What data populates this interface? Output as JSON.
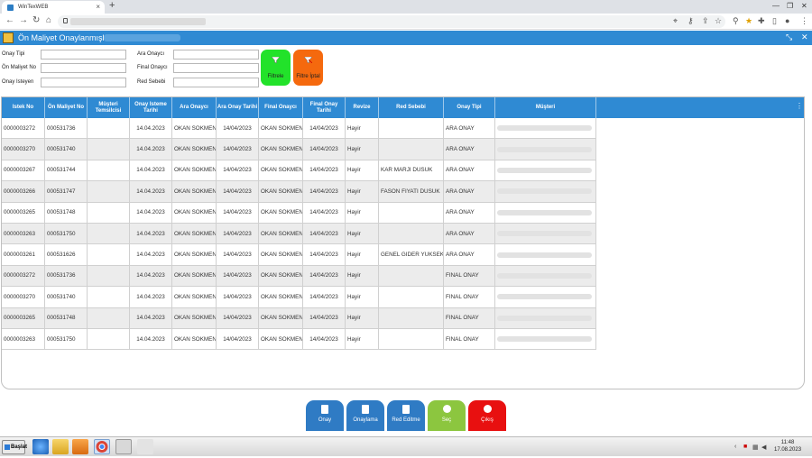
{
  "browser": {
    "tab_title": "WinTexWEB",
    "new_tab": "+",
    "tab_close": "×"
  },
  "app": {
    "title": "Ön Maliyet Onaylanmışlar /"
  },
  "filters": {
    "onay_tipi": "Onay Tipi",
    "on_maliyet_no": "Ön Maliyet No",
    "onay_isteyen": "Onay Isteyen",
    "ara_onayci": "Ara Onaycı",
    "final_onayci": "Final Onaycı",
    "red_sebebi": "Red Sebebi",
    "filter_button": "Filtrele",
    "filter_cancel_button": "Filtre İptal"
  },
  "table": {
    "columns": [
      "Istek No",
      "Ön Maliyet No",
      "Müşteri Temsilcisi",
      "Onay Isteme Tarihi",
      "Ara Onaycı",
      "Ara Onay Tarihi",
      "Final Onaycı",
      "Final Onay Tarihi",
      "Revize",
      "Red Sebebi",
      "Onay Tipi",
      "Müşteri"
    ],
    "rows": [
      {
        "istek_no": "0000003272",
        "on_maliyet_no": "000531736",
        "temsilci": "",
        "isteme_tarihi": "14.04.2023",
        "ara_onayci": "OKAN SOKMEN",
        "ara_onay_tarihi": "14/04/2023",
        "final_onayci": "OKAN SOKMEN",
        "final_onay_tarihi": "14/04/2023",
        "revize": "Hayir",
        "red_sebebi": "",
        "onay_tipi": "ARA ONAY"
      },
      {
        "istek_no": "0000003270",
        "on_maliyet_no": "000531740",
        "temsilci": "",
        "isteme_tarihi": "14.04.2023",
        "ara_onayci": "OKAN SOKMEN",
        "ara_onay_tarihi": "14/04/2023",
        "final_onayci": "OKAN SOKMEN",
        "final_onay_tarihi": "14/04/2023",
        "revize": "Hayir",
        "red_sebebi": "",
        "onay_tipi": "ARA ONAY"
      },
      {
        "istek_no": "0000003267",
        "on_maliyet_no": "000531744",
        "temsilci": "",
        "isteme_tarihi": "14.04.2023",
        "ara_onayci": "OKAN SOKMEN",
        "ara_onay_tarihi": "14/04/2023",
        "final_onayci": "OKAN SOKMEN",
        "final_onay_tarihi": "14/04/2023",
        "revize": "Hayir",
        "red_sebebi": "KAR MARJI DUSUK",
        "onay_tipi": "ARA ONAY"
      },
      {
        "istek_no": "0000003266",
        "on_maliyet_no": "000531747",
        "temsilci": "",
        "isteme_tarihi": "14.04.2023",
        "ara_onayci": "OKAN SOKMEN",
        "ara_onay_tarihi": "14/04/2023",
        "final_onayci": "OKAN SOKMEN",
        "final_onay_tarihi": "14/04/2023",
        "revize": "Hayir",
        "red_sebebi": "FASON FIYATI DUSUK",
        "onay_tipi": "ARA ONAY"
      },
      {
        "istek_no": "0000003265",
        "on_maliyet_no": "000531748",
        "temsilci": "",
        "isteme_tarihi": "14.04.2023",
        "ara_onayci": "OKAN SOKMEN",
        "ara_onay_tarihi": "14/04/2023",
        "final_onayci": "OKAN SOKMEN",
        "final_onay_tarihi": "14/04/2023",
        "revize": "Hayir",
        "red_sebebi": "",
        "onay_tipi": "ARA ONAY"
      },
      {
        "istek_no": "0000003263",
        "on_maliyet_no": "000531750",
        "temsilci": "",
        "isteme_tarihi": "14.04.2023",
        "ara_onayci": "OKAN SOKMEN",
        "ara_onay_tarihi": "14/04/2023",
        "final_onayci": "OKAN SOKMEN",
        "final_onay_tarihi": "14/04/2023",
        "revize": "Hayir",
        "red_sebebi": "",
        "onay_tipi": "ARA ONAY"
      },
      {
        "istek_no": "0000003261",
        "on_maliyet_no": "000531626",
        "temsilci": "",
        "isteme_tarihi": "14.04.2023",
        "ara_onayci": "OKAN SOKMEN",
        "ara_onay_tarihi": "14/04/2023",
        "final_onayci": "OKAN SOKMEN",
        "final_onay_tarihi": "14/04/2023",
        "revize": "Hayir",
        "red_sebebi": "GENEL GIDER YUKSEK",
        "onay_tipi": "ARA ONAY"
      },
      {
        "istek_no": "0000003272",
        "on_maliyet_no": "000531736",
        "temsilci": "",
        "isteme_tarihi": "14.04.2023",
        "ara_onayci": "OKAN SOKMEN",
        "ara_onay_tarihi": "14/04/2023",
        "final_onayci": "OKAN SOKMEN",
        "final_onay_tarihi": "14/04/2023",
        "revize": "Hayir",
        "red_sebebi": "",
        "onay_tipi": "FINAL ONAY"
      },
      {
        "istek_no": "0000003270",
        "on_maliyet_no": "000531740",
        "temsilci": "",
        "isteme_tarihi": "14.04.2023",
        "ara_onayci": "OKAN SOKMEN",
        "ara_onay_tarihi": "14/04/2023",
        "final_onayci": "OKAN SOKMEN",
        "final_onay_tarihi": "14/04/2023",
        "revize": "Hayir",
        "red_sebebi": "",
        "onay_tipi": "FINAL ONAY"
      },
      {
        "istek_no": "0000003265",
        "on_maliyet_no": "000531748",
        "temsilci": "",
        "isteme_tarihi": "14.04.2023",
        "ara_onayci": "OKAN SOKMEN",
        "ara_onay_tarihi": "14/04/2023",
        "final_onayci": "OKAN SOKMEN",
        "final_onay_tarihi": "14/04/2023",
        "revize": "Hayir",
        "red_sebebi": "",
        "onay_tipi": "FINAL ONAY"
      },
      {
        "istek_no": "0000003263",
        "on_maliyet_no": "000531750",
        "temsilci": "",
        "isteme_tarihi": "14.04.2023",
        "ara_onayci": "OKAN SOKMEN",
        "ara_onay_tarihi": "14/04/2023",
        "final_onayci": "OKAN SOKMEN",
        "final_onay_tarihi": "14/04/2023",
        "revize": "Hayir",
        "red_sebebi": "",
        "onay_tipi": "FINAL ONAY"
      }
    ]
  },
  "bottom_buttons": [
    {
      "label": "Onay",
      "color": "#2f7bc4",
      "icon": "document-icon"
    },
    {
      "label": "Onaylama",
      "color": "#2f7bc4",
      "icon": "edit-icon"
    },
    {
      "label": "Red Editme",
      "color": "#2f7bc4",
      "icon": "reject-doc-icon"
    },
    {
      "label": "Seç",
      "color": "#8cc63f",
      "icon": "check-circle-icon"
    },
    {
      "label": "Çıkış",
      "color": "#e81010",
      "icon": "power-icon"
    }
  ],
  "taskbar": {
    "start_label": "Başlat",
    "time": "11:48",
    "date": "17.08.2023"
  },
  "colors": {
    "accent": "#2f8ad3",
    "filter_button": "#22e22a",
    "filter_cancel_button": "#f5690e"
  }
}
